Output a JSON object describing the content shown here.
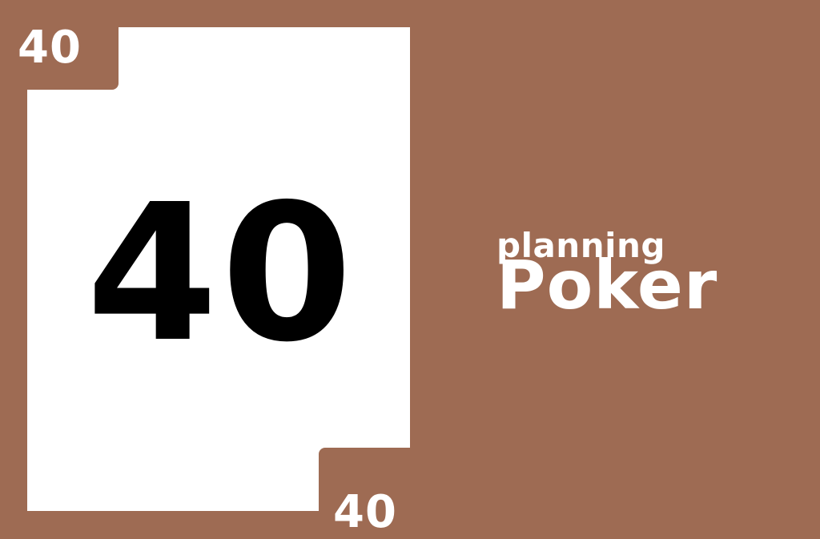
{
  "colors": {
    "background": "#9e6b53",
    "card": "#ffffff",
    "card_text": "#000000",
    "corner_text": "#ffffff"
  },
  "card": {
    "value": "40",
    "corner_top_left": "40",
    "corner_bottom_right": "40"
  },
  "brand": {
    "line1": "planning",
    "line2": "Poker"
  }
}
